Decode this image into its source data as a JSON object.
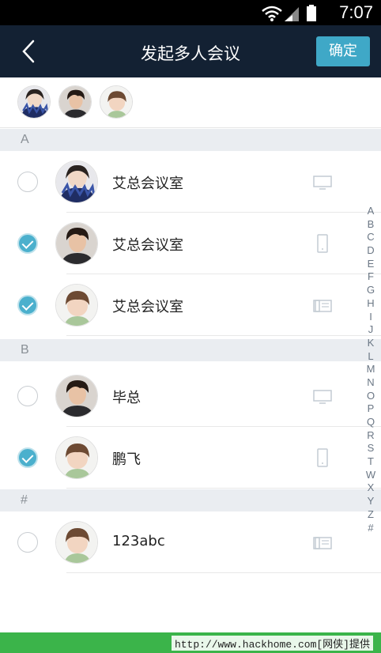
{
  "status_bar": {
    "time": "7:07"
  },
  "header": {
    "title": "发起多人会议",
    "confirm_label": "确定"
  },
  "selected": [
    {
      "avatar": "avatar-woman-scarf"
    },
    {
      "avatar": "avatar-man"
    },
    {
      "avatar": "avatar-child"
    }
  ],
  "sections": [
    {
      "letter": "A"
    },
    {
      "letter": "B"
    },
    {
      "letter": "#"
    }
  ],
  "contacts": [
    {
      "name": "艾总会议室",
      "checked": false,
      "avatar": "avatar-woman-scarf",
      "device": "monitor-icon"
    },
    {
      "name": "艾总会议室",
      "checked": true,
      "avatar": "avatar-man",
      "device": "phone-icon"
    },
    {
      "name": "艾总会议室",
      "checked": true,
      "avatar": "avatar-child",
      "device": "desk-phone-icon"
    },
    {
      "name": "毕总",
      "checked": false,
      "avatar": "avatar-man",
      "device": "monitor-icon"
    },
    {
      "name": "鹏飞",
      "checked": true,
      "avatar": "avatar-child",
      "device": "phone-icon"
    },
    {
      "name": "123abc",
      "checked": false,
      "avatar": "avatar-child",
      "device": "desk-phone-icon"
    }
  ],
  "index_letters": [
    "A",
    "B",
    "C",
    "D",
    "E",
    "F",
    "G",
    "H",
    "I",
    "J",
    "K",
    "L",
    "M",
    "N",
    "O",
    "P",
    "Q",
    "R",
    "S",
    "T",
    "W",
    "X",
    "Y",
    "Z",
    "#"
  ],
  "footer": {
    "watermark": "http://www.hackhome.com[网侠]提供"
  },
  "colors": {
    "header_bg": "#132133",
    "accent": "#3fa8c7",
    "section_bg": "#eaedf1",
    "footer_bg": "#3bb44a"
  }
}
